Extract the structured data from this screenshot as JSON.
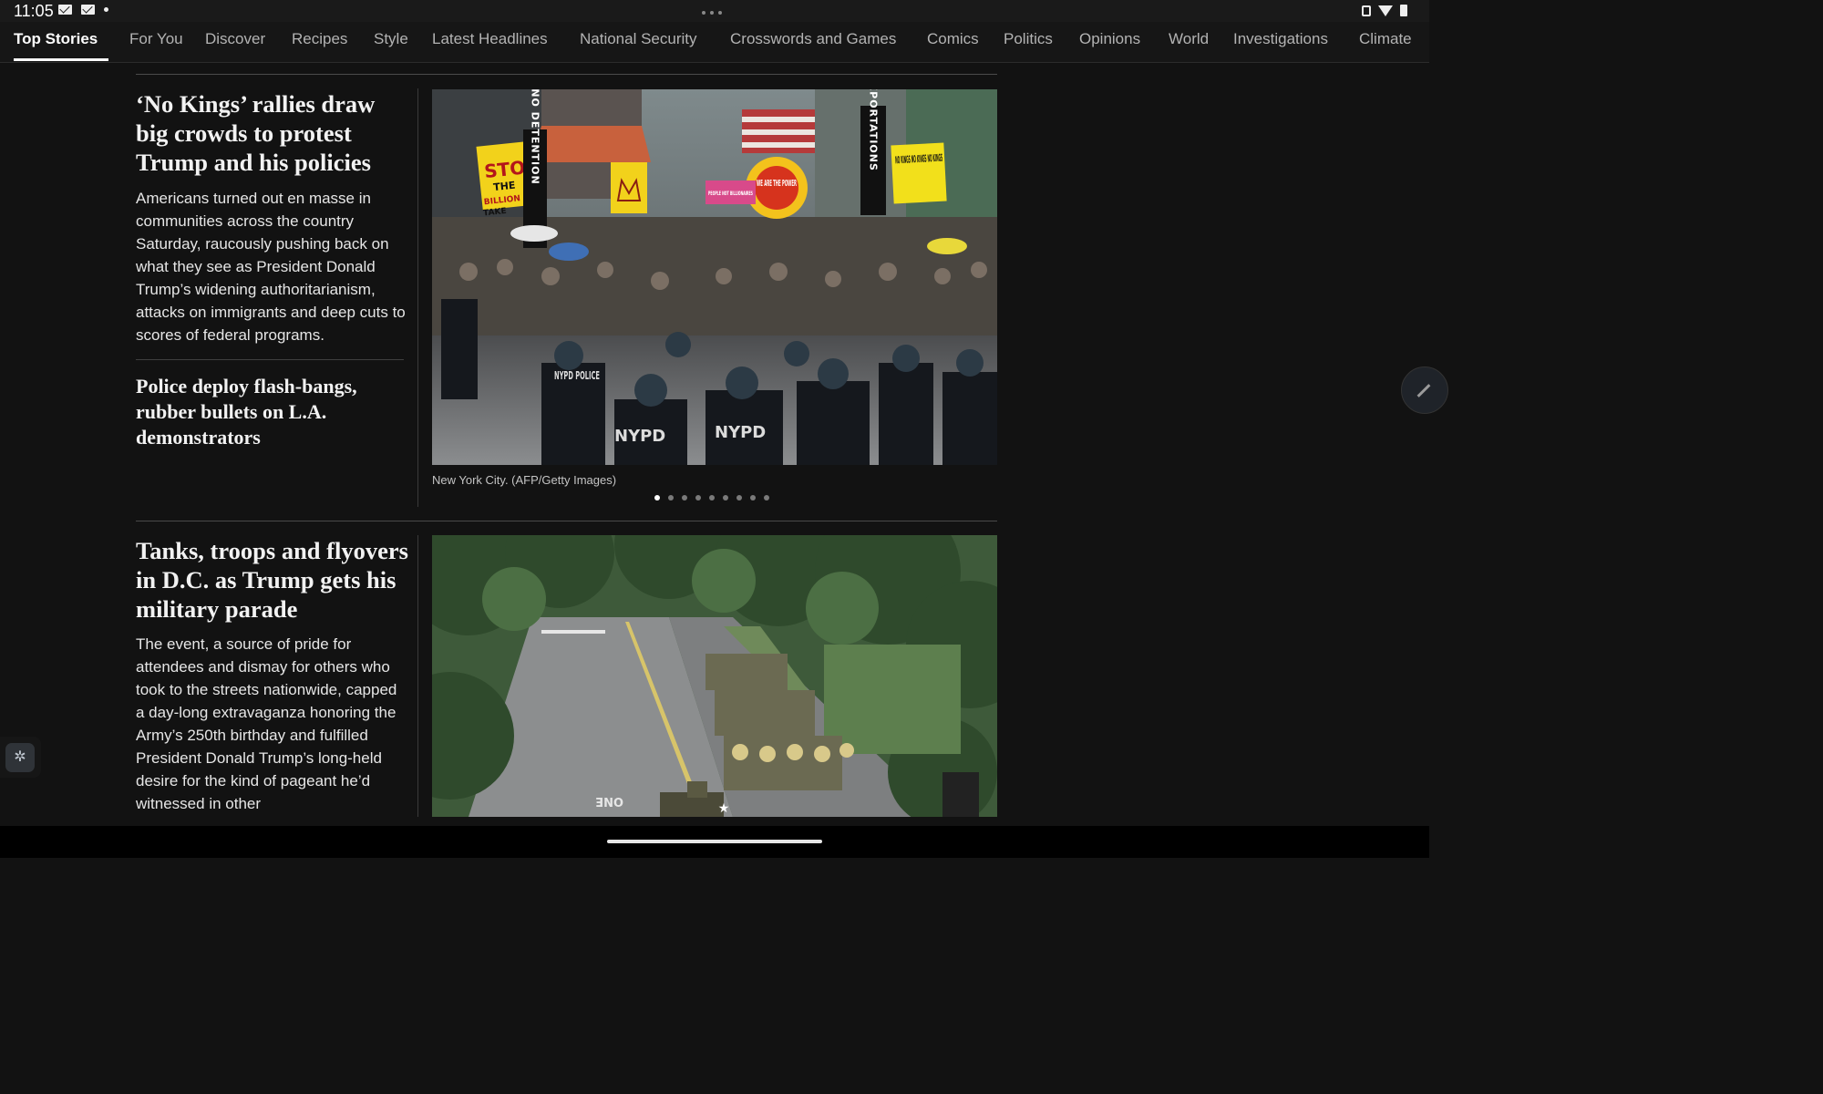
{
  "status_bar": {
    "time": "11:05",
    "left_icons": [
      "mail-icon",
      "mail-icon",
      "notification-dot-icon"
    ],
    "right_icons": [
      "vibrate-icon",
      "wifi-icon",
      "battery-icon"
    ]
  },
  "tabs": [
    {
      "label": "Top Stories",
      "active": true
    },
    {
      "label": "For You"
    },
    {
      "label": "Discover"
    },
    {
      "label": "Recipes"
    },
    {
      "label": "Style"
    },
    {
      "label": "Latest Headlines"
    },
    {
      "label": "National Security"
    },
    {
      "label": "Crosswords and Games"
    },
    {
      "label": "Comics"
    },
    {
      "label": "Politics"
    },
    {
      "label": "Opinions"
    },
    {
      "label": "World"
    },
    {
      "label": "Investigations"
    },
    {
      "label": "Climate"
    }
  ],
  "stories": {
    "lead": {
      "headline": "‘No Kings’ rallies draw big crowds to protest Trump and his policies",
      "summary": "Americans turned out en masse in communities across the country Saturday, raucously pushing back on what they see as President Donald Trump’s widening authoritarianism, attacks on immigrants and deep cuts to scores of federal programs.",
      "photo_caption": "New York City. (AFP/Getty Images)",
      "carousel_count": 9,
      "carousel_active": 1
    },
    "related": {
      "headline": "Police deploy flash-bangs, rubber bullets on L.A. demonstrators"
    },
    "second": {
      "headline": "Tanks, troops and flyovers in D.C. as Trump gets his military parade",
      "summary": "The event, a source of pride for attendees and dismay for others who took to the streets nationwide, capped a day-long extravaganza honoring the Army’s 250th birthday and fulfilled President Donald Trump’s long-held desire for the kind of pageant he’d witnessed in other"
    }
  },
  "photo_signs": {
    "stop": "STOP",
    "the": "THE",
    "billion": "BILLION",
    "take": "TAKE",
    "no_detention": "NO DETENTION",
    "no_deportations": "NO DEPORTATIONS",
    "no_kings": "NO KINGS NO KINGS NO KINGS",
    "we_are_the_power": "WE ARE THE POWER",
    "people_not_billionaires": "PEOPLE NOT BILLIONAIRES",
    "nypd_police": "NYPD POLICE",
    "nypd": "NYPD",
    "road_marking": "ONE"
  },
  "colors": {
    "background": "#121212",
    "tab_active": "#ffffff",
    "tab_inactive": "#b3b3b3"
  }
}
